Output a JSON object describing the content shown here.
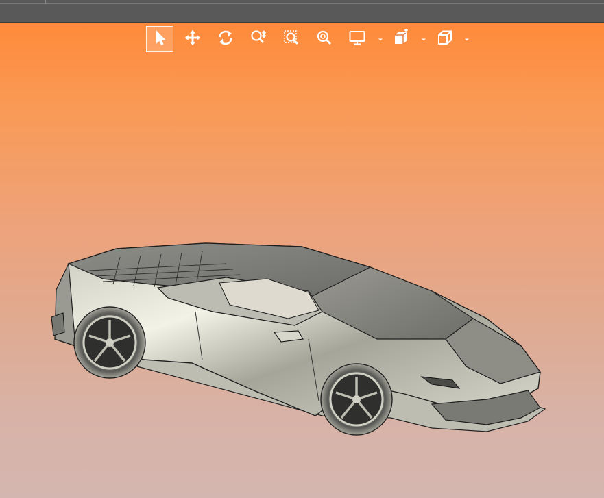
{
  "window": {
    "accent": "#595959"
  },
  "viewport": {
    "background_top": "#ff8a3a",
    "background_bottom": "#d4b6b0",
    "model": "car-3d-model"
  },
  "toolbar": {
    "buttons": [
      {
        "icon": "select-arrow-icon",
        "active": true
      },
      {
        "icon": "pan-move-icon",
        "active": false
      },
      {
        "icon": "rotate-icon",
        "active": false
      },
      {
        "icon": "zoom-icon",
        "active": false
      },
      {
        "icon": "zoom-window-icon",
        "active": false
      },
      {
        "icon": "zoom-fit-icon",
        "active": false
      },
      {
        "icon": "display-monitor-icon",
        "active": false,
        "has_dropdown": true
      },
      {
        "icon": "shading-cube-icon",
        "active": false,
        "has_dropdown": true
      },
      {
        "icon": "view-cube-icon",
        "active": false,
        "has_dropdown": true
      }
    ]
  }
}
